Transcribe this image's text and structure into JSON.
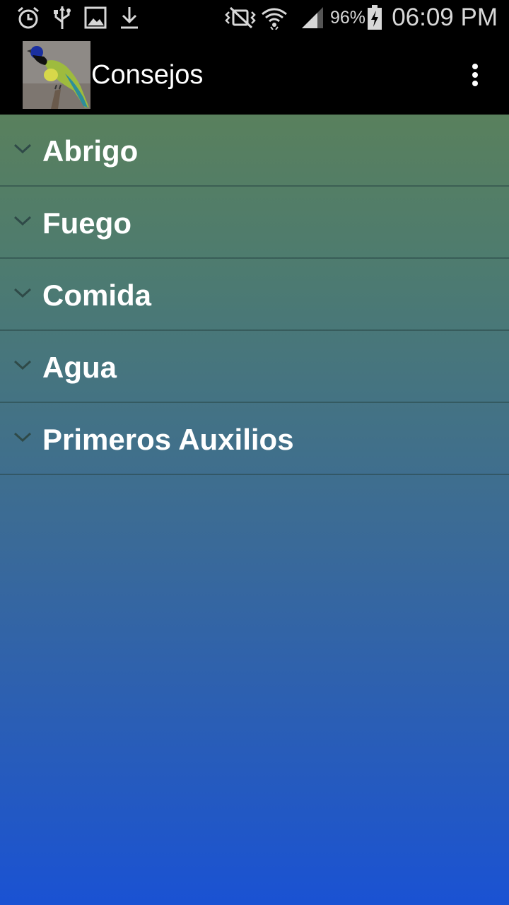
{
  "status_bar": {
    "battery_percent": "96%",
    "time": "06:09 PM",
    "icons": [
      "alarm-icon",
      "usb-icon",
      "gallery-icon",
      "download-icon",
      "vibrate-mute-icon",
      "wifi-icon",
      "signal-icon",
      "battery-charging-icon"
    ]
  },
  "action_bar": {
    "title": "Consejos",
    "logo": "bird-logo",
    "overflow_icon": "more-vert-icon"
  },
  "groups": [
    {
      "label": "Abrigo"
    },
    {
      "label": "Fuego"
    },
    {
      "label": "Comida"
    },
    {
      "label": "Agua"
    },
    {
      "label": "Primeros Auxilios"
    }
  ],
  "colors": {
    "bar_background": "#000000",
    "gradient_top": "#62844f",
    "gradient_bottom": "#1a52d3",
    "text": "#ffffff"
  }
}
